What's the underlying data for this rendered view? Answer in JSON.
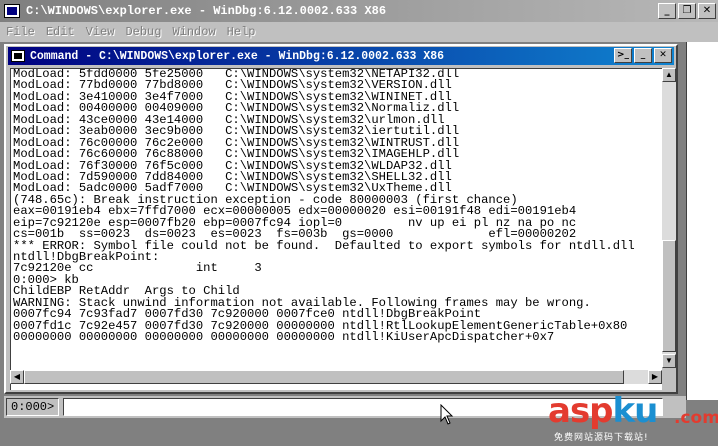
{
  "window": {
    "title": "C:\\WINDOWS\\explorer.exe - WinDbg:6.12.0002.633 X86",
    "minimize_glyph": "_",
    "restore_glyph": "❐",
    "close_glyph": "✕"
  },
  "menu": {
    "items": [
      "File",
      "Edit",
      "View",
      "Debug",
      "Window",
      "Help"
    ]
  },
  "command_window": {
    "title": "Command - C:\\WINDOWS\\explorer.exe - WinDbg:6.12.0002.633 X86",
    "output": [
      "ModLoad: 5fdd0000 5fe25000   C:\\WINDOWS\\system32\\NETAPI32.dll",
      "ModLoad: 77bd0000 77bd8000   C:\\WINDOWS\\system32\\VERSION.dll",
      "ModLoad: 3e410000 3e4f7000   C:\\WINDOWS\\system32\\WININET.dll",
      "ModLoad: 00400000 00409000   C:\\WINDOWS\\system32\\Normaliz.dll",
      "ModLoad: 43ce0000 43e14000   C:\\WINDOWS\\system32\\urlmon.dll",
      "ModLoad: 3eab0000 3ec9b000   C:\\WINDOWS\\system32\\iertutil.dll",
      "ModLoad: 76c00000 76c2e000   C:\\WINDOWS\\system32\\WINTRUST.dll",
      "ModLoad: 76c60000 76c88000   C:\\WINDOWS\\system32\\IMAGEHLP.dll",
      "ModLoad: 76f30000 76f5c000   C:\\WINDOWS\\system32\\WLDAP32.dll",
      "ModLoad: 7d590000 7dd84000   C:\\WINDOWS\\system32\\SHELL32.dll",
      "ModLoad: 5adc0000 5adf7000   C:\\WINDOWS\\system32\\UxTheme.dll",
      "(748.65c): Break instruction exception - code 80000003 (first chance)",
      "eax=00191eb4 ebx=7ffd7000 ecx=00000005 edx=00000020 esi=00191f48 edi=00191eb4",
      "eip=7c92120e esp=0007fb20 ebp=0007fc94 iopl=0         nv up ei pl nz na po nc",
      "cs=001b  ss=0023  ds=0023  es=0023  fs=003b  gs=0000             efl=00000202",
      "*** ERROR: Symbol file could not be found.  Defaulted to export symbols for ntdll.dll",
      "ntdll!DbgBreakPoint:",
      "7c92120e cc              int     3",
      "0:000> kb",
      "ChildEBP RetAddr  Args to Child",
      "WARNING: Stack unwind information not available. Following frames may be wrong.",
      "0007fc94 7c93fad7 0007fd30 7c920000 0007fce0 ntdll!DbgBreakPoint",
      "0007fd1c 7c92e457 0007fd30 7c920000 00000000 ntdll!RtlLookupElementGenericTable+0x80",
      "00000000 00000000 00000000 00000000 00000000 ntdll!KiUserApcDispatcher+0x7"
    ]
  },
  "command_bar": {
    "prompt": "0:000>",
    "input_value": ""
  },
  "watermark": {
    "brand_part1": "asp",
    "brand_part2": "ku",
    "brand_suffix": ".com",
    "tagline": "免费网站源码下载站!"
  }
}
